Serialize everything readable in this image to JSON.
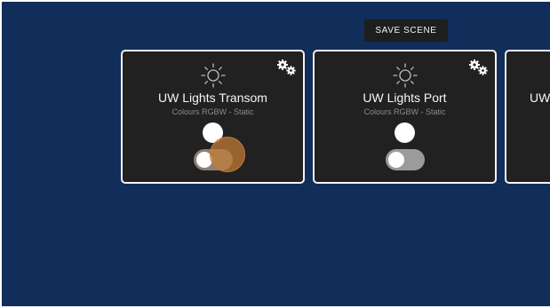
{
  "toolbar": {
    "save_scene_label": "SAVE SCENE"
  },
  "cards": [
    {
      "title": "UW Lights Transom",
      "subtitle": "Colours RGBW - Static",
      "icon": "sun-icon",
      "settings_icon": "gears-icon",
      "status": "on",
      "toggle_on": false
    },
    {
      "title": "UW Lights Port",
      "subtitle": "Colours RGBW - Static",
      "icon": "sun-icon",
      "settings_icon": "gears-icon",
      "status": "on",
      "toggle_on": false
    },
    {
      "title": "UW"
    }
  ],
  "colors": {
    "background": "#112d5a",
    "card": "#212121",
    "card_border": "#f3f3f3",
    "ripple": "#c77a32"
  }
}
